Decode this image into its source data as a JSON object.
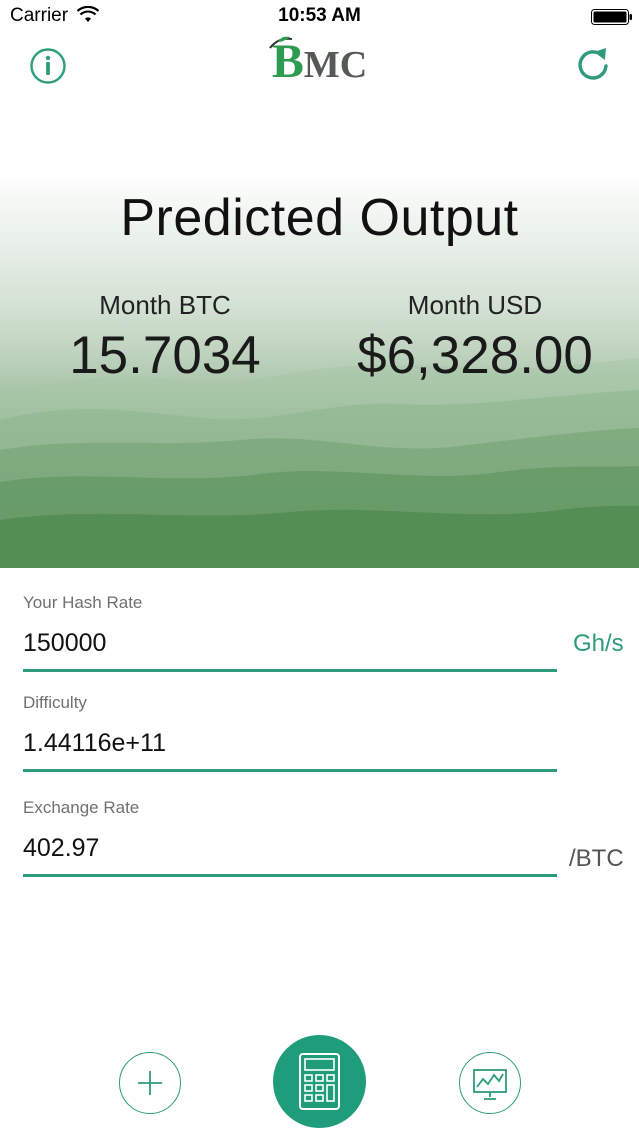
{
  "status_bar": {
    "carrier": "Carrier",
    "time": "10:53 AM"
  },
  "nav": {
    "info_icon": "info-icon",
    "refresh_icon": "refresh-icon",
    "logo_b": "B",
    "logo_rest": "MC"
  },
  "prediction": {
    "title": "Predicted Output",
    "btc_label": "Month BTC",
    "btc_value": "15.7034",
    "usd_label": "Month USD",
    "usd_value": "$6,328.00"
  },
  "form": {
    "hash_rate_label": "Your Hash Rate",
    "hash_rate_value": "150000",
    "hash_rate_unit": "Gh/s",
    "difficulty_label": "Difficulty",
    "difficulty_value": "1.44116e+11",
    "exchange_rate_label": "Exchange Rate",
    "exchange_rate_value": "402.97",
    "exchange_rate_unit": "/BTC"
  },
  "toolbar": {
    "add_icon": "plus-icon",
    "calculator_icon": "calculator-icon",
    "chart_icon": "chart-icon"
  },
  "colors": {
    "accent": "#2e9b7b",
    "accent_fill": "#1f9d7a",
    "logo_green": "#2e9b52"
  }
}
